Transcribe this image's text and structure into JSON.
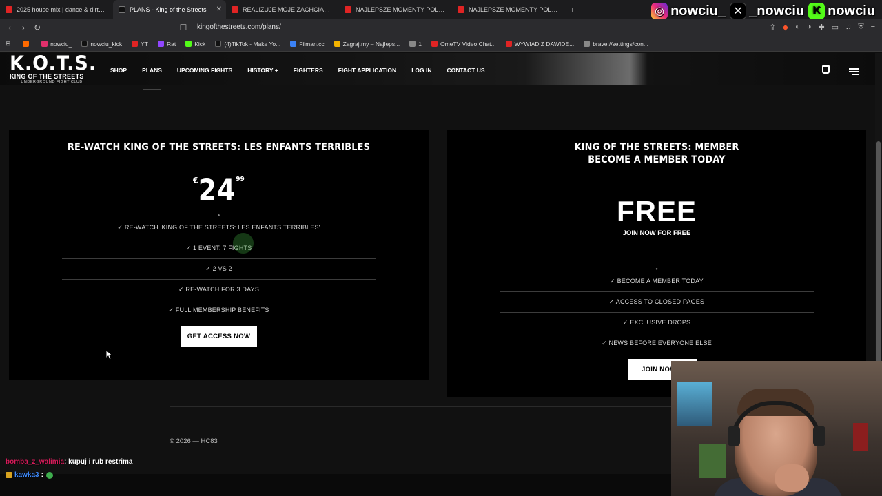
{
  "browser": {
    "tabs": [
      {
        "title": "2025 house mix | dance & dirty g",
        "icon": "youtube-icon",
        "active": false
      },
      {
        "title": "PLANS - King of the Streets",
        "icon": "kots-favicon",
        "active": true
      },
      {
        "title": "REALIZUJE MOJE ZACHCIANKI CIĄŻO",
        "icon": "youtube-icon",
        "active": false
      },
      {
        "title": "NAJLEPSZE MOMENTY POLSKIEGO T",
        "icon": "youtube-icon",
        "active": false
      },
      {
        "title": "NAJLEPSZE MOMENTY POLSKIEGO T",
        "icon": "youtube-icon",
        "active": false
      }
    ],
    "new_tab": "+",
    "url": "kingofthestreets.com/plans/",
    "bookmarks": [
      {
        "label": "",
        "color": "#ff6a00"
      },
      {
        "label": "nowciu_",
        "color": "#e1306c"
      },
      {
        "label": "nowciu_kick",
        "color": "#111111"
      },
      {
        "label": "YT",
        "color": "#e02424"
      },
      {
        "label": "Rat",
        "color": "#9146ff"
      },
      {
        "label": "Kick",
        "color": "#53fc18"
      },
      {
        "label": "(4)TikTok - Make Yo...",
        "color": "#111111"
      },
      {
        "label": "Filman.cc",
        "color": "#3b82f6"
      },
      {
        "label": "Zagraj.my – Najleps...",
        "color": "#f4b400"
      },
      {
        "label": "1",
        "color": "#888888"
      },
      {
        "label": "OmeTV Video Chat...",
        "color": "#e02424"
      },
      {
        "label": "WYWIAD Z DAWIDE...",
        "color": "#e02424"
      },
      {
        "label": "brave://settings/con...",
        "color": "#888888"
      }
    ]
  },
  "stream_overlay": {
    "instagram": "nowciu_",
    "x": "_nowciu",
    "kick": "nowciu"
  },
  "site": {
    "logo": "K.O.T.S.",
    "logo_sub": "KING OF THE STREETS",
    "logo_sub2": "UNDERGROUND FIGHT CLUB",
    "nav": [
      "SHOP",
      "PLANS",
      "UPCOMING FIGHTS",
      "HISTORY +",
      "FIGHTERS",
      "FIGHT APPLICATION",
      "LOG IN",
      "CONTACT US"
    ]
  },
  "plans": [
    {
      "title": "RE-WATCH KING OF THE STREETS: LES ENFANTS TERRIBLES",
      "currency": "€",
      "price": "24",
      "cents": "99",
      "features": [
        "✓ RE-WATCH 'KING OF THE STREETS: LES ENFANTS TERRIBLES'",
        "✓ 1 EVENT: 7 FIGHTS",
        "✓ 2 VS 2",
        "✓ RE-WATCH FOR 3 DAYS",
        "✓ FULL MEMBERSHIP BENEFITS"
      ],
      "cta": "GET ACCESS NOW"
    },
    {
      "title_line1": "KING OF THE STREETS: MEMBER",
      "title_line2": "BECOME A MEMBER TODAY",
      "price": "FREE",
      "price_sub": "JOIN NOW FOR FREE",
      "features": [
        "✓ BECOME A MEMBER TODAY",
        "✓ ACCESS TO CLOSED PAGES",
        "✓ EXCLUSIVE DROPS",
        "✓ NEWS BEFORE EVERYONE ELSE"
      ],
      "cta": "JOIN NOW"
    }
  ],
  "footer": {
    "copyright": "© 2026 — HC83"
  },
  "chat": [
    {
      "user": "bomba_z_walimia",
      "message": ": kupuj i rub restrima"
    },
    {
      "user": "kawka3",
      "message": ":"
    }
  ]
}
